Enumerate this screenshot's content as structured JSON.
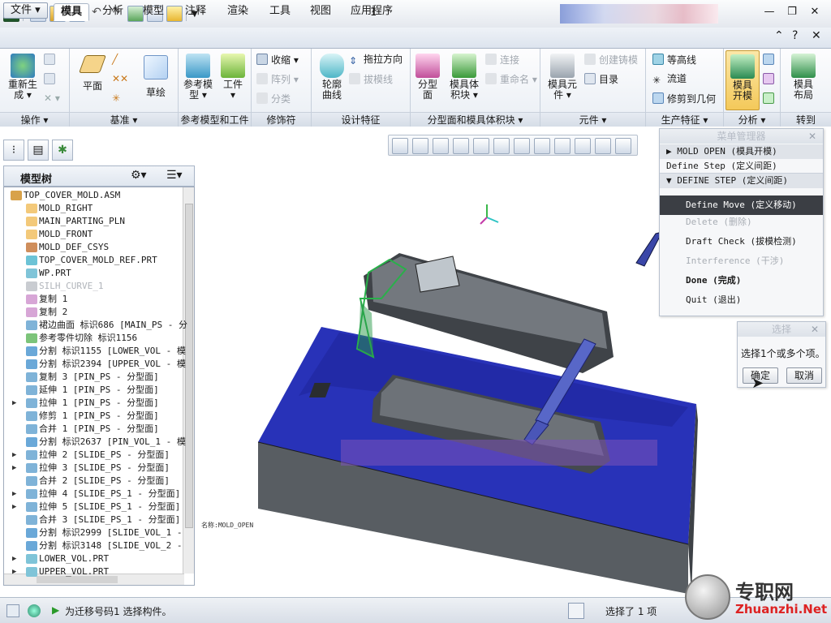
{
  "window": {
    "title": "1"
  },
  "qat": {
    "icons": [
      "app-icon",
      "new-icon",
      "open-icon",
      "save-icon",
      "undo-icon",
      "redo-icon",
      "regenerate-icon",
      "windows-icon",
      "folder-icon",
      "customize-icon"
    ]
  },
  "tabs": [
    {
      "label": "文件 ▾",
      "active": false
    },
    {
      "label": "模具",
      "active": true
    },
    {
      "label": "分析",
      "active": false
    },
    {
      "label": "模型",
      "active": false
    },
    {
      "label": "注释",
      "active": false
    },
    {
      "label": "渲染",
      "active": false
    },
    {
      "label": "工具",
      "active": false
    },
    {
      "label": "视图",
      "active": false
    },
    {
      "label": "应用程序",
      "active": false
    }
  ],
  "ribbon": {
    "groups": [
      "操作 ▾",
      "基准 ▾",
      "参考模型和工件",
      "修饰符",
      "设计特征",
      "分型面和模具体积块 ▾",
      "元件 ▾",
      "生产特征 ▾",
      "分析 ▾",
      "转到"
    ],
    "ops": {
      "regen": "重新生\n成 ▾"
    },
    "datum": {
      "plane": "平面",
      "sketch": "草绘"
    },
    "refmodel": {
      "ref": "参考模\n型 ▾",
      "workpiece": "工件\n▾"
    },
    "modifier": {
      "shrink": "收缩 ▾",
      "pattern": "阵列 ▾",
      "split": "分类"
    },
    "design": {
      "profile": "轮廓\n曲线",
      "draft_dir": "拖拉方向",
      "draft_line": "拔模线"
    },
    "parting": {
      "surface": "分型\n面",
      "volume": "模具体\n积块 ▾",
      "connect": "连接",
      "rename": "重命名 ▾"
    },
    "components": {
      "mold_comp": "模具元\n件 ▾",
      "create_cast": "创建铸模",
      "catalog": "目录"
    },
    "production": {
      "contour": "等高线",
      "flow": "流道",
      "trim": "修剪到几何"
    },
    "analysis": {
      "mold_open": "模具\n开模"
    },
    "goto": {
      "layout": "模具\n布局"
    }
  },
  "model_tree": {
    "title": "模型树",
    "items": [
      {
        "text": "TOP_COVER_MOLD.ASM",
        "color": "#d8a24a",
        "expand": "",
        "root": true,
        "dim": false
      },
      {
        "text": "MOLD_RIGHT",
        "color": "#f3c97a",
        "expand": "",
        "root": false,
        "dim": false
      },
      {
        "text": "MAIN_PARTING_PLN",
        "color": "#f3c97a",
        "expand": "",
        "root": false,
        "dim": false
      },
      {
        "text": "MOLD_FRONT",
        "color": "#f3c97a",
        "expand": "",
        "root": false,
        "dim": false
      },
      {
        "text": "MOLD_DEF_CSYS",
        "color": "#cf8e5c",
        "expand": "",
        "root": false,
        "dim": false
      },
      {
        "text": "TOP_COVER_MOLD_REF.PRT",
        "color": "#6cc3d6",
        "expand": "",
        "root": false,
        "dim": false
      },
      {
        "text": "WP.PRT",
        "color": "#7fc4d8",
        "expand": "",
        "root": false,
        "dim": false
      },
      {
        "text": "SILH_CURVE_1",
        "color": "#c9ccd1",
        "expand": "",
        "root": false,
        "dim": true
      },
      {
        "text": "复制 1",
        "color": "#d7a6d6",
        "expand": "",
        "root": false,
        "dim": false
      },
      {
        "text": "复制 2",
        "color": "#d7a6d6",
        "expand": "",
        "root": false,
        "dim": false
      },
      {
        "text": "裙边曲面 标识686 [MAIN_PS - 分",
        "color": "#7fb3d8",
        "expand": "",
        "root": false,
        "dim": false
      },
      {
        "text": "参考零件切除 标识1156",
        "color": "#7cc47a",
        "expand": "",
        "root": false,
        "dim": false
      },
      {
        "text": "分割 标识1155 [LOWER_VOL - 模",
        "color": "#6aa8d8",
        "expand": "",
        "root": false,
        "dim": false
      },
      {
        "text": "分割 标识2394 [UPPER_VOL - 模",
        "color": "#6aa8d8",
        "expand": "",
        "root": false,
        "dim": false
      },
      {
        "text": "复制 3 [PIN_PS - 分型面]",
        "color": "#7fb3d8",
        "expand": "",
        "root": false,
        "dim": false
      },
      {
        "text": "延伸 1 [PIN_PS - 分型面]",
        "color": "#7fb3d8",
        "expand": "",
        "root": false,
        "dim": false
      },
      {
        "text": "拉伸 1 [PIN_PS - 分型面]",
        "color": "#7fb3d8",
        "expand": "▶",
        "root": false,
        "dim": false
      },
      {
        "text": "修剪 1 [PIN_PS - 分型面]",
        "color": "#7fb3d8",
        "expand": "",
        "root": false,
        "dim": false
      },
      {
        "text": "合并 1 [PIN_PS - 分型面]",
        "color": "#7fb3d8",
        "expand": "",
        "root": false,
        "dim": false
      },
      {
        "text": "分割 标识2637 [PIN_VOL_1 - 模",
        "color": "#6aa8d8",
        "expand": "",
        "root": false,
        "dim": false
      },
      {
        "text": "拉伸 2 [SLIDE_PS - 分型面]",
        "color": "#7fb3d8",
        "expand": "▶",
        "root": false,
        "dim": false
      },
      {
        "text": "拉伸 3 [SLIDE_PS - 分型面]",
        "color": "#7fb3d8",
        "expand": "▶",
        "root": false,
        "dim": false
      },
      {
        "text": "合并 2 [SLIDE_PS - 分型面]",
        "color": "#7fb3d8",
        "expand": "",
        "root": false,
        "dim": false
      },
      {
        "text": "拉伸 4 [SLIDE_PS_1 - 分型面]",
        "color": "#7fb3d8",
        "expand": "▶",
        "root": false,
        "dim": false
      },
      {
        "text": "拉伸 5 [SLIDE_PS_1 - 分型面]",
        "color": "#7fb3d8",
        "expand": "▶",
        "root": false,
        "dim": false
      },
      {
        "text": "合并 3 [SLIDE_PS_1 - 分型面]",
        "color": "#7fb3d8",
        "expand": "",
        "root": false,
        "dim": false
      },
      {
        "text": "分割 标识2999 [SLIDE_VOL_1 -",
        "color": "#6aa8d8",
        "expand": "",
        "root": false,
        "dim": false
      },
      {
        "text": "分割 标识3148 [SLIDE_VOL_2 -",
        "color": "#6aa8d8",
        "expand": "",
        "root": false,
        "dim": false
      },
      {
        "text": "LOWER_VOL.PRT",
        "color": "#7fc4d8",
        "expand": "▶",
        "root": false,
        "dim": false
      },
      {
        "text": "UPPER_VOL.PRT",
        "color": "#7fc4d8",
        "expand": "▶",
        "root": false,
        "dim": false
      }
    ]
  },
  "viewport": {
    "label": "名称:MOLD_OPEN"
  },
  "menu_manager": {
    "title": "菜单管理器",
    "items": [
      {
        "text": "▶ MOLD OPEN (模具开模)",
        "kind": "header"
      },
      {
        "text": "Define Step (定义间距)",
        "kind": "select"
      },
      {
        "text": "▼ DEFINE STEP (定义间距)",
        "kind": "header"
      },
      {
        "text": "Define Move (定义移动)",
        "kind": "selected"
      },
      {
        "text": "Delete (删除)",
        "kind": "disabled"
      },
      {
        "text": "Draft Check (拔模检测)",
        "kind": "normal"
      },
      {
        "text": "Interference (干涉)",
        "kind": "disabled"
      },
      {
        "text": "Done (完成)",
        "kind": "bold"
      },
      {
        "text": "Quit (退出)",
        "kind": "normal"
      }
    ]
  },
  "select_dialog": {
    "title": "选择",
    "prompt": "选择1个或多个项。",
    "ok": "确定",
    "cancel": "取消"
  },
  "status": {
    "message": "为迁移号码1 选择构件。",
    "selection": "选择了 1 项"
  },
  "watermark": {
    "text1": "专职网",
    "text2": "Zhuanzhi.Net"
  }
}
